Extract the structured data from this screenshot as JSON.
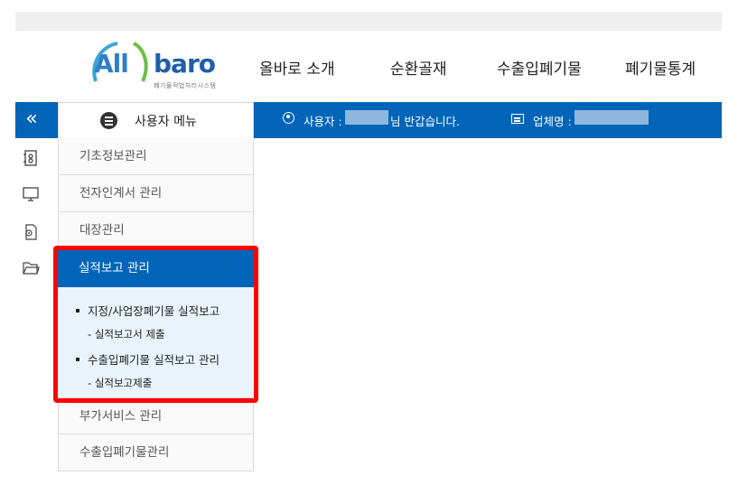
{
  "logo": {
    "brand_left": "All",
    "brand_right": "baro",
    "tagline": "폐기물적법처리시스템"
  },
  "gnb": {
    "items": [
      "올바로 소개",
      "순환골재",
      "수출입폐기물",
      "폐기물통계"
    ]
  },
  "bluebar": {
    "collapse_icon": "«",
    "menu_label": "사용자 메뉴",
    "user_prefix": "사용자 :",
    "user_suffix": "님 반갑습니다.",
    "company_prefix": "업체명 :"
  },
  "side_menu": {
    "items_top": [
      "기초정보관리",
      "전자인계서 관리",
      "대장관리"
    ],
    "active": {
      "label": "실적보고 관리",
      "groups": [
        {
          "label": "지정/사업장폐기물 실적보고",
          "child": "실적보고서 제출"
        },
        {
          "label": "수출입폐기물 실적보고 관리",
          "child": "실적보고제출"
        }
      ]
    },
    "items_bottom": [
      "부가서비스 관리",
      "수출입폐기물관리"
    ]
  },
  "colors": {
    "primary_blue": "#0065b8",
    "highlight_red": "#ff0000",
    "active_body": "#e9f3fb"
  }
}
